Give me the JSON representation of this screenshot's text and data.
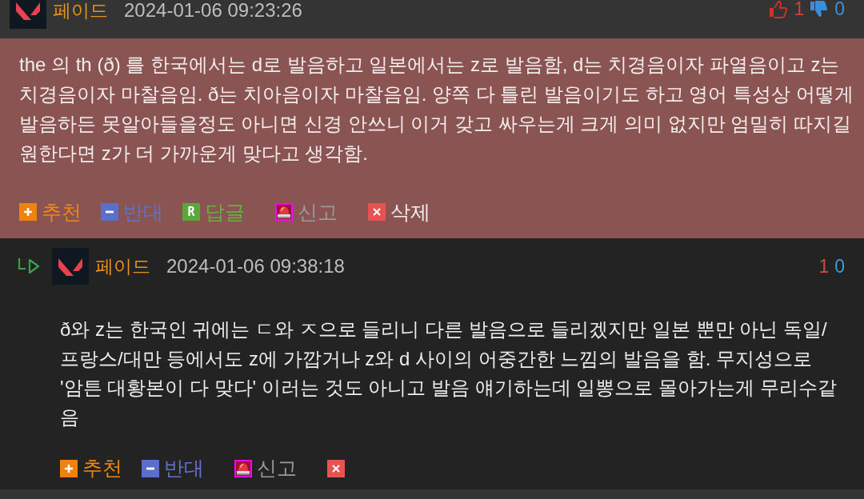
{
  "comments": [
    {
      "kind": "comment",
      "highlighted": true,
      "author": "페이드",
      "time": "2024-01-06 09:23:26",
      "likes": "1",
      "dislikes": "0",
      "body": "the 의 th (ð) 를 한국에서는 d로 발음하고 일본에서는 z로 발음함, d는 치경음이자 파열음이고 z는 치경음이자 마찰음임. ð는 치아음이자 마찰음임. 양쪽 다 틀린 발음이기도 하고 영어 특성상 어떻게 발음하든 못알아들을정도 아니면 신경 안쓰니 이거 갖고 싸우는게 크게 의미 없지만 엄밀히 따지길 원한다면 z가 더 가까운게 맞다고 생각함.",
      "actions": [
        {
          "kind": "recommend",
          "label": "추천"
        },
        {
          "kind": "oppose",
          "label": "반대"
        },
        {
          "kind": "reply",
          "icon_letter": "R",
          "label": "답글"
        },
        {
          "kind": "report",
          "label": "신고"
        },
        {
          "kind": "delete",
          "label": "삭제"
        }
      ]
    },
    {
      "kind": "reply",
      "highlighted": false,
      "author": "페이드",
      "time": "2024-01-06 09:38:18",
      "likes": "1",
      "dislikes": "0",
      "body": "ð와 z는 한국인 귀에는 ㄷ와 ㅈ으로 들리니 다른 발음으로 들리겠지만 일본 뿐만 아닌 독일/프랑스/대만 등에서도 z에 가깝거나 z와 d 사이의 어중간한 느낌의 발음을 함. 무지성으로 '암튼 대황본이 다 맞다' 이러는 것도 아니고 발음 얘기하는데 일뽕으로 몰아가는게 무리수같음",
      "actions": [
        {
          "kind": "recommend",
          "label": "추천"
        },
        {
          "kind": "oppose",
          "label": "반대"
        },
        {
          "kind": "report",
          "label": "신고"
        },
        {
          "kind": "delete"
        }
      ]
    }
  ]
}
